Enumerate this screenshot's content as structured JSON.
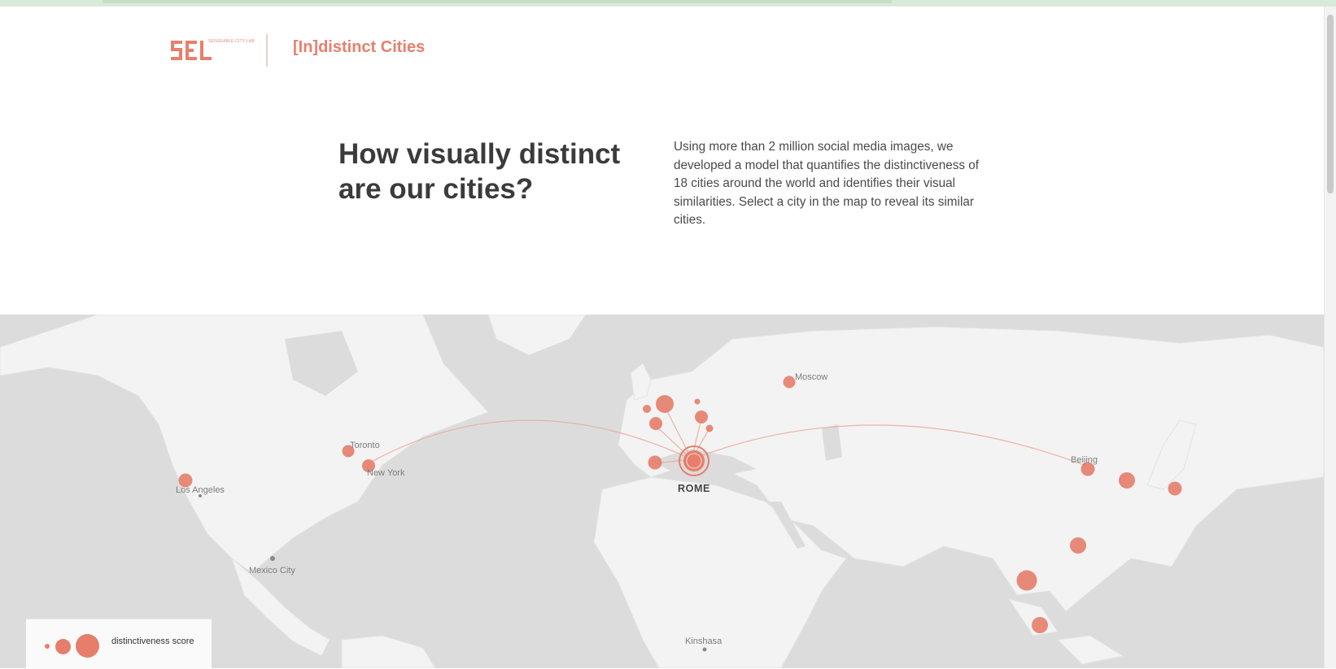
{
  "header": {
    "logo_subtext": "SENSEABLE CITY LAB",
    "site_title": "[In]distinct Cities"
  },
  "intro": {
    "headline": "How visually distinct are our cities?",
    "description": "Using more than 2 million social media images, we developed a model that quantifies the distinctiveness of 18 cities around the world and identifies their visual similarities. Select a city in the map to reveal its similar cities."
  },
  "map": {
    "selected_city": "ROME",
    "labels": {
      "moscow": "Moscow",
      "toronto": "Toronto",
      "new_york": "New York",
      "los_angeles": "Los Angeles",
      "mexico_city": "Mexico City",
      "beijing": "Beijing",
      "kinshasa": "Kinshasa"
    }
  },
  "legend": {
    "label": "distinctiveness score"
  },
  "colors": {
    "accent": "#e67e6b",
    "map_water": "#dcdcdc",
    "map_land": "#f3f3f3",
    "text_dark": "#3b3b3b"
  }
}
